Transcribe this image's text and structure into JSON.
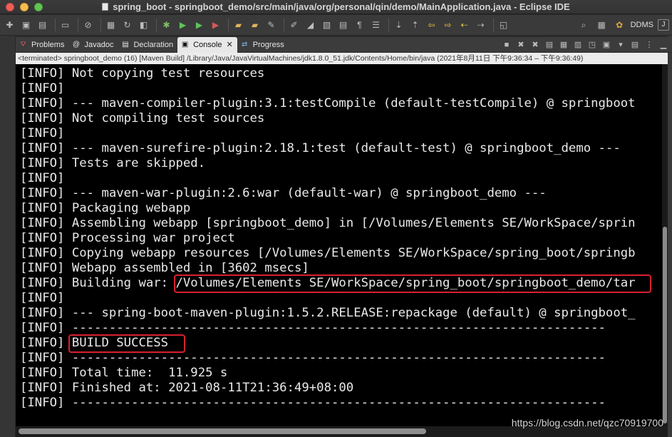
{
  "window": {
    "title": "spring_boot - springboot_demo/src/main/java/org/personal/qin/demo/MainApplication.java - Eclipse IDE"
  },
  "toolbar": {
    "perspective_label": "DDMS"
  },
  "view_tabs": [
    {
      "label": "Problems",
      "icon": "problems-icon"
    },
    {
      "label": "Javadoc",
      "icon": "javadoc-icon"
    },
    {
      "label": "Declaration",
      "icon": "declaration-icon"
    },
    {
      "label": "Console",
      "icon": "console-icon",
      "active": true
    },
    {
      "label": "Progress",
      "icon": "progress-icon"
    }
  ],
  "console_status": "<terminated> springboot_demo (16) [Maven Build] /Library/Java/JavaVirtualMachines/jdk1.8.0_51.jdk/Contents/Home/bin/java  (2021年8月11日 下午9:36:34 – 下午9:36:49)",
  "console_lines": [
    "[INFO] Not copying test resources",
    "[INFO]",
    "[INFO] --- maven-compiler-plugin:3.1:testCompile (default-testCompile) @ springboot",
    "[INFO] Not compiling test sources",
    "[INFO]",
    "[INFO] --- maven-surefire-plugin:2.18.1:test (default-test) @ springboot_demo ---",
    "[INFO] Tests are skipped.",
    "[INFO]",
    "[INFO] --- maven-war-plugin:2.6:war (default-war) @ springboot_demo ---",
    "[INFO] Packaging webapp",
    "[INFO] Assembling webapp [springboot_demo] in [/Volumes/Elements SE/WorkSpace/sprin",
    "[INFO] Processing war project",
    "[INFO] Copying webapp resources [/Volumes/Elements SE/WorkSpace/spring_boot/springb",
    "[INFO] Webapp assembled in [3602 msecs]",
    "[INFO] Building war: /Volumes/Elements SE/WorkSpace/spring_boot/springboot_demo/tar",
    "[INFO]",
    "[INFO] --- spring-boot-maven-plugin:1.5.2.RELEASE:repackage (default) @ springboot_",
    "[INFO] ------------------------------------------------------------------------",
    "[INFO] BUILD SUCCESS",
    "[INFO] ------------------------------------------------------------------------",
    "[INFO] Total time:  11.925 s",
    "[INFO] Finished at: 2021-08-11T21:36:49+08:00",
    "[INFO] ------------------------------------------------------------------------"
  ],
  "highlights": [
    {
      "line_index": 14,
      "label": "war-path-highlight"
    },
    {
      "line_index": 18,
      "label": "build-success-highlight"
    }
  ],
  "watermark": "https://blog.csdn.net/qzc70919700",
  "colors": {
    "highlight": "#d8202e",
    "console_bg": "#000000",
    "console_text": "#e9e9e9"
  }
}
